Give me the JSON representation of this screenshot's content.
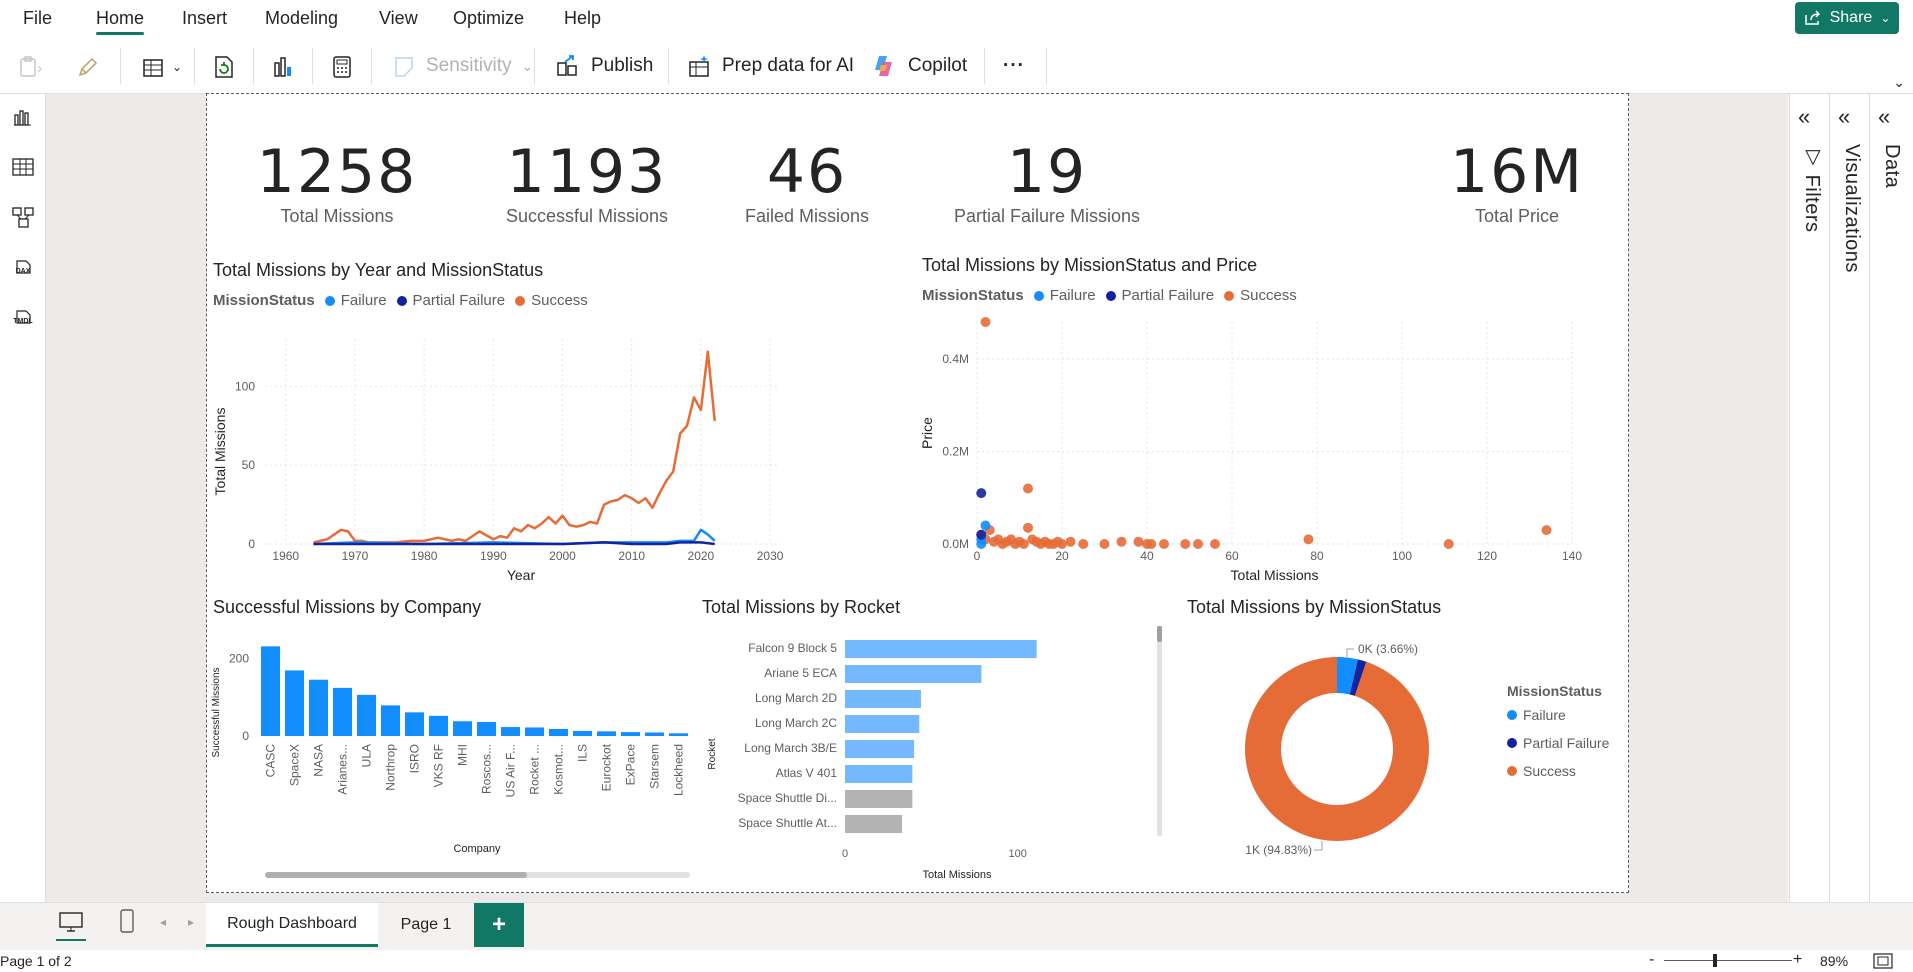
{
  "menu": {
    "items": [
      "File",
      "Home",
      "Insert",
      "Modeling",
      "View",
      "Optimize",
      "Help"
    ],
    "active": "Home",
    "share_label": "Share"
  },
  "toolbar": {
    "sensitivity_label": "Sensitivity",
    "publish_label": "Publish",
    "prep_label": "Prep data for AI",
    "copilot_label": "Copilot",
    "more_label": "···"
  },
  "rail": {
    "dax_label": "DAX",
    "tmdl_label": "TMDL"
  },
  "panes": {
    "filters": "Filters",
    "visualizations": "Visualizations",
    "data": "Data"
  },
  "kpis": [
    {
      "value": "1258",
      "label": "Total Missions"
    },
    {
      "value": "1193",
      "label": "Successful Missions"
    },
    {
      "value": "46",
      "label": "Failed Missions"
    },
    {
      "value": "19",
      "label": "Partial Failure Missions"
    },
    {
      "value": "16M",
      "label": "Total Price"
    }
  ],
  "colors": {
    "failure": "#118dff",
    "partial_failure": "#12239e",
    "success": "#e66c37",
    "bar_blue": "#118dff",
    "bar_light": "#74b9ff",
    "bar_grey": "#b3b3b3",
    "accent": "#117865"
  },
  "legend": {
    "title": "MissionStatus",
    "failure": "Failure",
    "partial_failure": "Partial Failure",
    "success": "Success"
  },
  "chart_data": [
    {
      "type": "line",
      "title": "Total Missions by Year and MissionStatus",
      "xlabel": "Year",
      "ylabel": "Total Missions",
      "xlim": [
        1957,
        2031
      ],
      "ylim": [
        0,
        130
      ],
      "xticks": [
        "1960",
        "1970",
        "1980",
        "1990",
        "2000",
        "2010",
        "2020",
        "2030"
      ],
      "yticks": [
        "0",
        "50",
        "100"
      ],
      "legend_position": "top-left",
      "series": [
        {
          "name": "Success",
          "x": [
            1964,
            1966,
            1968,
            1969,
            1970,
            1971,
            1972,
            1974,
            1976,
            1978,
            1980,
            1982,
            1984,
            1985,
            1986,
            1988,
            1990,
            1991,
            1992,
            1993,
            1994,
            1995,
            1996,
            1997,
            1998,
            1999,
            2000,
            2001,
            2002,
            2003,
            2004,
            2005,
            2006,
            2007,
            2008,
            2009,
            2010,
            2011,
            2012,
            2013,
            2014,
            2015,
            2016,
            2017,
            2018,
            2019,
            2020,
            2021,
            2022
          ],
          "values": [
            1,
            3,
            9,
            8,
            2,
            2,
            1,
            1,
            1,
            2,
            2,
            4,
            2,
            3,
            2,
            8,
            3,
            5,
            4,
            10,
            8,
            12,
            10,
            13,
            17,
            13,
            18,
            12,
            11,
            12,
            14,
            13,
            25,
            27,
            28,
            31,
            29,
            26,
            29,
            23,
            32,
            40,
            46,
            70,
            75,
            93,
            85,
            122,
            78
          ]
        },
        {
          "name": "Failure",
          "x": [
            1964,
            1970,
            1980,
            1990,
            2000,
            2006,
            2010,
            2015,
            2017,
            2018,
            2019,
            2020,
            2021,
            2022
          ],
          "values": [
            0,
            1,
            0,
            1,
            0,
            1,
            1,
            1,
            2,
            2,
            2,
            9,
            6,
            2
          ]
        },
        {
          "name": "Partial Failure",
          "x": [
            1964,
            1970,
            1980,
            1990,
            2000,
            2006,
            2010,
            2015,
            2017,
            2020,
            2022
          ],
          "values": [
            0,
            0,
            0,
            0,
            0,
            1,
            0,
            0,
            1,
            1,
            0
          ]
        }
      ]
    },
    {
      "type": "scatter",
      "title": "Total Missions by MissionStatus and Price",
      "xlabel": "Total Missions",
      "ylabel": "Price",
      "xlim": [
        0,
        140
      ],
      "ylim": [
        0,
        0.48
      ],
      "xticks": [
        "0",
        "20",
        "40",
        "60",
        "80",
        "100",
        "120",
        "140"
      ],
      "yticks": [
        "0.0M",
        "0.2M",
        "0.4M"
      ],
      "legend_position": "top-left",
      "series": [
        {
          "name": "Success",
          "points": [
            [
              2,
              0.48
            ],
            [
              12,
              0.12
            ],
            [
              1,
              0.02
            ],
            [
              2,
              0.01
            ],
            [
              3,
              0.03
            ],
            [
              4,
              0.005
            ],
            [
              5,
              0.01
            ],
            [
              6,
              0.0
            ],
            [
              7,
              0.005
            ],
            [
              8,
              0.01
            ],
            [
              9,
              0.0
            ],
            [
              10,
              0.005
            ],
            [
              11,
              0.0
            ],
            [
              12,
              0.035
            ],
            [
              13,
              0.01
            ],
            [
              14,
              0.005
            ],
            [
              15,
              0.0
            ],
            [
              16,
              0.005
            ],
            [
              17,
              0.0
            ],
            [
              18,
              0.0
            ],
            [
              19,
              0.005
            ],
            [
              20,
              0.0
            ],
            [
              22,
              0.005
            ],
            [
              25,
              0.0
            ],
            [
              30,
              0.0
            ],
            [
              34,
              0.005
            ],
            [
              38,
              0.005
            ],
            [
              40,
              0.0
            ],
            [
              41,
              0.0
            ],
            [
              44,
              0.0
            ],
            [
              49,
              0.0
            ],
            [
              52,
              0.0
            ],
            [
              56,
              0.0
            ],
            [
              78,
              0.01
            ],
            [
              111,
              0.0
            ],
            [
              134,
              0.03
            ]
          ]
        },
        {
          "name": "Failure",
          "points": [
            [
              1,
              0.0
            ],
            [
              2,
              0.04
            ],
            [
              1,
              0.01
            ]
          ]
        },
        {
          "name": "Partial Failure",
          "points": [
            [
              1,
              0.11
            ],
            [
              1,
              0.02
            ]
          ]
        }
      ]
    },
    {
      "type": "bar",
      "title": "Successful Missions by Company",
      "xlabel": "Company",
      "ylabel": "Successful Missions",
      "ylim": [
        0,
        250
      ],
      "yticks": [
        "0",
        "200"
      ],
      "categories": [
        "CASC",
        "SpaceX",
        "NASA",
        "Arianes...",
        "ULA",
        "Northrop",
        "ISRO",
        "VKS RF",
        "MHI",
        "Roscos...",
        "US Air F...",
        "Rocket ...",
        "Kosmot...",
        "ILS",
        "Eurockot",
        "ExPace",
        "Starsem",
        "Lockheed"
      ],
      "values": [
        231,
        169,
        145,
        124,
        106,
        79,
        61,
        52,
        38,
        36,
        23,
        22,
        18,
        13,
        12,
        10,
        9,
        7
      ]
    },
    {
      "type": "bar",
      "orientation": "horizontal",
      "title": "Total Missions by Rocket",
      "xlabel": "Total Missions",
      "ylabel": "Rocket",
      "xlim": [
        0,
        130
      ],
      "xticks": [
        "0",
        "100"
      ],
      "categories": [
        "Falcon 9 Block 5",
        "Ariane 5 ECA",
        "Long March 2D",
        "Long March 2C",
        "Long March 3B/E",
        "Atlas V 401",
        "Space Shuttle Di...",
        "Space Shuttle At..."
      ],
      "values": [
        111,
        79,
        44,
        43,
        40,
        39,
        39,
        33
      ],
      "highlight": [
        true,
        true,
        true,
        true,
        true,
        true,
        false,
        false
      ]
    },
    {
      "type": "pie",
      "title": "Total Missions by MissionStatus",
      "legend_position": "right",
      "series": [
        {
          "name": "Failure",
          "value": 46
        },
        {
          "name": "Partial Failure",
          "value": 19
        },
        {
          "name": "Success",
          "value": 1193
        }
      ],
      "labels": [
        "0K (3.66%)",
        "1K (94.83%)"
      ]
    }
  ],
  "pages": {
    "tabs": [
      "Rough Dashboard",
      "Page 1"
    ],
    "active": "Rough Dashboard",
    "add_label": "+"
  },
  "status": {
    "page_info": "Page 1 of 2",
    "zoom": "89%",
    "zoom_minus": "-",
    "zoom_plus": "+"
  }
}
